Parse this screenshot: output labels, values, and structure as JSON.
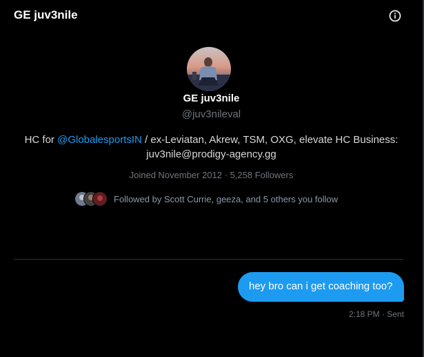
{
  "header": {
    "title": "GE juv3nile",
    "info_icon": "info-circle-icon"
  },
  "profile": {
    "display_name": "GE juv3nile",
    "handle": "@juv3nileval",
    "bio_prefix": "HC for ",
    "bio_mention": "@GlobalesportsIN",
    "bio_suffix": " / ex-Leviatan, Akrew, TSM, OXG, elevate HC Business: juv3nile@prodigy-agency.gg",
    "joined": "Joined November 2012",
    "separator": " · ",
    "followers": "5,258 Followers",
    "followed_by": "Followed by Scott Currie, geeza, and 5 others you follow"
  },
  "conversation": {
    "messages": [
      {
        "text": "hey bro can i get coaching too?",
        "time": "2:18 PM",
        "status": "Sent",
        "meta": "2:18 PM · Sent"
      }
    ]
  },
  "colors": {
    "background": "#000000",
    "accent": "#1d9bf0",
    "muted": "#6e767d",
    "divider": "#2f3336"
  }
}
